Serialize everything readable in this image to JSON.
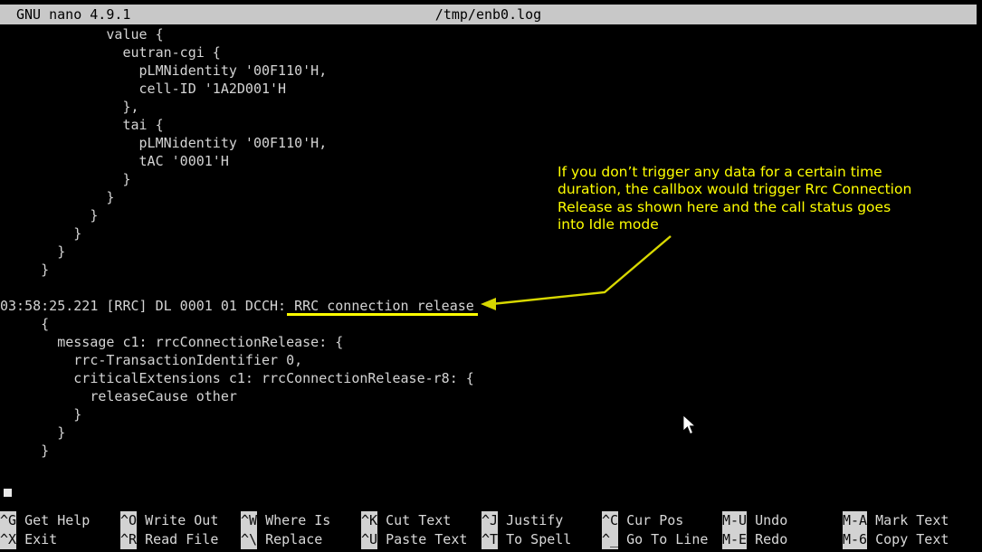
{
  "titlebar": {
    "app": "GNU nano 4.9.1",
    "filename": "/tmp/enb0.log"
  },
  "editor": {
    "font_color": "#d4d4d4",
    "background": "#000000",
    "lines": [
      "             value {",
      "               eutran-cgi {",
      "                 pLMNidentity '00F110'H,",
      "                 cell-ID '1A2D001'H",
      "               },",
      "               tai {",
      "                 pLMNidentity '00F110'H,",
      "                 tAC '0001'H",
      "               }",
      "             }",
      "           }",
      "         }",
      "       }",
      "     }",
      "",
      "03:58:25.221 [RRC] DL 0001 01 DCCH: RRC connection release",
      "     {",
      "       message c1: rrcConnectionRelease: {",
      "         rrc-TransactionIdentifier 0,",
      "         criticalExtensions c1: rrcConnectionRelease-r8: {",
      "           releaseCause other",
      "         }",
      "       }",
      "     }"
    ],
    "highlighted_phrase": "RRC connection release"
  },
  "annotation": {
    "text": "If you don’t trigger any data for a certain time duration, the callbox would trigger Rrc Connection Release as shown here and the call status goes into Idle mode",
    "color": "#ffff00"
  },
  "shortcutbar": {
    "columns": [
      {
        "rows": [
          {
            "key": "^G",
            "label": " Get Help"
          },
          {
            "key": "^X",
            "label": " Exit"
          }
        ]
      },
      {
        "rows": [
          {
            "key": "^O",
            "label": " Write Out"
          },
          {
            "key": "^R",
            "label": " Read File"
          }
        ]
      },
      {
        "rows": [
          {
            "key": "^W",
            "label": " Where Is"
          },
          {
            "key": "^\\",
            "label": " Replace"
          }
        ]
      },
      {
        "rows": [
          {
            "key": "^K",
            "label": " Cut Text"
          },
          {
            "key": "^U",
            "label": " Paste Text"
          }
        ]
      },
      {
        "rows": [
          {
            "key": "^J",
            "label": " Justify"
          },
          {
            "key": "^T",
            "label": " To Spell"
          }
        ]
      },
      {
        "rows": [
          {
            "key": "^C",
            "label": " Cur Pos"
          },
          {
            "key": "^_",
            "label": " Go To Line"
          }
        ]
      },
      {
        "rows": [
          {
            "key": "M-U",
            "label": " Undo"
          },
          {
            "key": "M-E",
            "label": " Redo"
          }
        ]
      },
      {
        "rows": [
          {
            "key": "M-A",
            "label": " Mark Text"
          },
          {
            "key": "M-6",
            "label": " Copy Text"
          }
        ]
      }
    ]
  }
}
